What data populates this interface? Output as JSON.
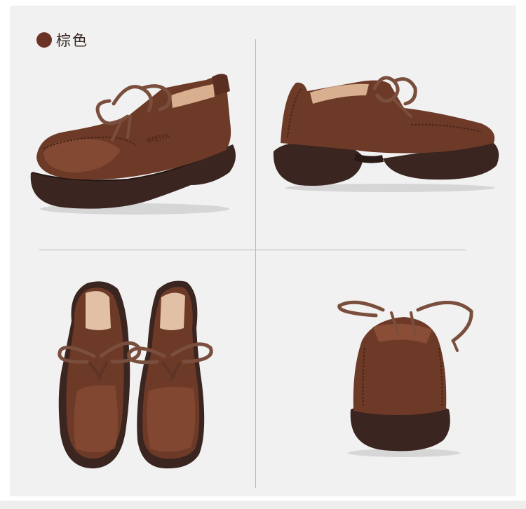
{
  "color_option": {
    "label": "棕色",
    "swatch_color": "#6b3327"
  },
  "colors": {
    "leather": "#6e3a28",
    "leather_light": "#8a4d35",
    "sole": "#3a2520",
    "lace": "#7a4e3c",
    "lining": "#e2c0a6"
  },
  "photos": [
    {
      "view": "side-front"
    },
    {
      "view": "side-back"
    },
    {
      "view": "top-pair"
    },
    {
      "view": "back-heel"
    }
  ]
}
